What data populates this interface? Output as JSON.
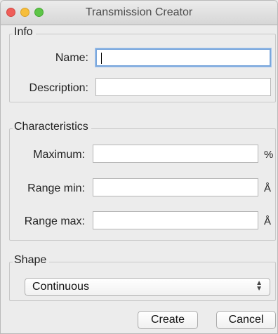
{
  "window": {
    "title": "Transmission Creator"
  },
  "info": {
    "legend": "Info",
    "name_label": "Name:",
    "name_value": "",
    "description_label": "Description:",
    "description_value": ""
  },
  "characteristics": {
    "legend": "Characteristics",
    "maximum_label": "Maximum:",
    "maximum_value": "",
    "maximum_unit": "%",
    "range_min_label": "Range min:",
    "range_min_value": "",
    "range_min_unit": "Å",
    "range_max_label": "Range max:",
    "range_max_value": "",
    "range_max_unit": "Å"
  },
  "shape": {
    "legend": "Shape",
    "selected": "Continuous"
  },
  "buttons": {
    "create": "Create",
    "cancel": "Cancel"
  },
  "colors": {
    "close": "#ef5e59",
    "minimize": "#f6be3b",
    "zoom": "#5dc547",
    "focus_ring": "#7aa7dc"
  },
  "icons": {
    "select_arrows": "up-down-chevron-icon"
  }
}
